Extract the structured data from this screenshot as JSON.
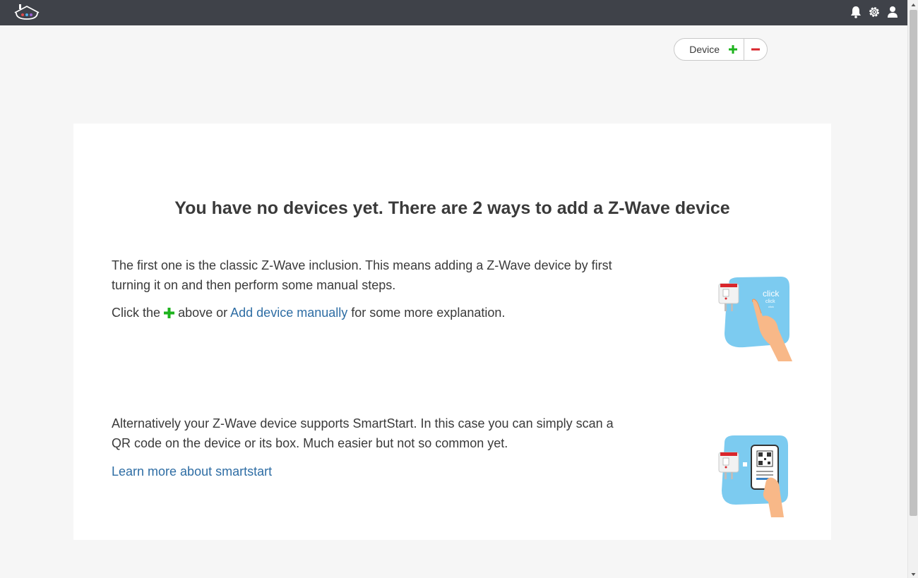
{
  "topbar": {
    "logo_icon": "house-logo-icon",
    "icons": [
      "bell-icon",
      "gear-icon",
      "user-icon"
    ],
    "background": "#3f4249"
  },
  "device_control": {
    "label": "Device",
    "add_symbol": "+",
    "add_color": "#1db31d",
    "remove_color": "#d9262c"
  },
  "main": {
    "title": "You have no devices yet. There are 2 ways to add a Z-Wave device",
    "classic": {
      "text": "The first one is the classic Z-Wave inclusion. This means adding a Z-Wave device by first turning it on and then perform some manual steps.",
      "click_prefix": "Click the",
      "click_middle": "above or",
      "link": "Add device manually",
      "click_suffix": "for some more explanation.",
      "illustration_text": "click",
      "illustration_sub1": "click",
      "illustration_sub2": "click"
    },
    "smartstart": {
      "text": "Alternatively your Z-Wave device supports SmartStart. In this case you can simply scan a QR code on the device or its box. Much easier but not so common yet.",
      "link": "Learn more about smartstart"
    }
  },
  "colors": {
    "link": "#2e6da4",
    "accent_blue": "#7ccbf0",
    "plus_green": "#1db31d"
  }
}
